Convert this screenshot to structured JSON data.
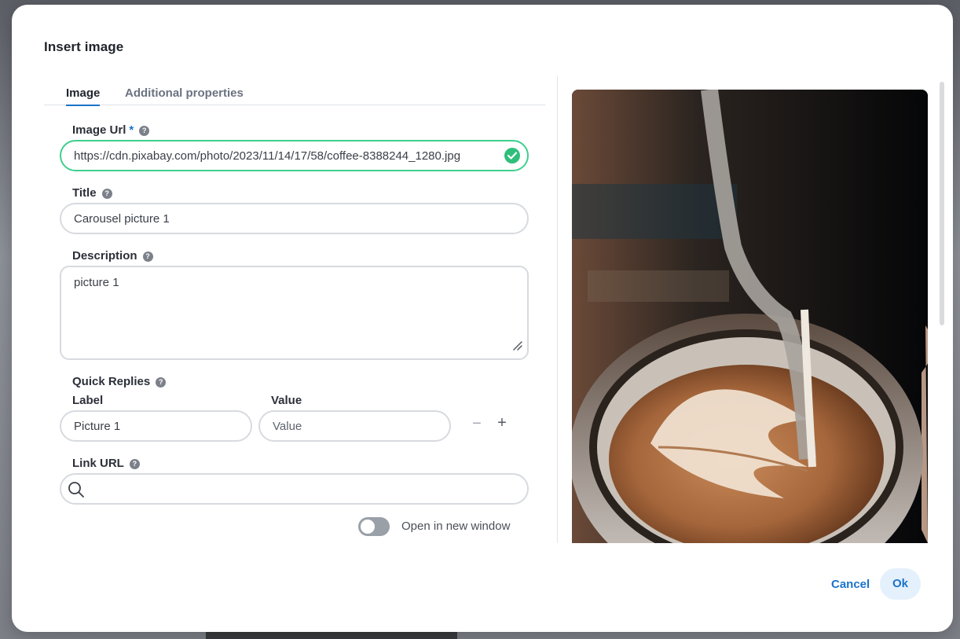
{
  "dialog": {
    "title": "Insert image"
  },
  "tabs": [
    {
      "label": "Image",
      "active": true
    },
    {
      "label": "Additional properties",
      "active": false
    }
  ],
  "form": {
    "image_url": {
      "label": "Image Url",
      "required_mark": "*",
      "value": "https://cdn.pixabay.com/photo/2023/11/14/17/58/coffee-8388244_1280.jpg",
      "status": "valid"
    },
    "title": {
      "label": "Title",
      "value": "Carousel picture 1"
    },
    "description": {
      "label": "Description",
      "value": "picture 1"
    },
    "quick_replies": {
      "label": "Quick Replies",
      "columns": {
        "label": "Label",
        "value": "Value"
      },
      "rows": [
        {
          "label": "Picture 1",
          "value_placeholder": "Value"
        }
      ],
      "remove_symbol": "−",
      "add_symbol": "+"
    },
    "link_url": {
      "label": "Link URL",
      "value": ""
    },
    "open_new_window": {
      "label": "Open in new window",
      "enabled": false
    }
  },
  "preview": {
    "subject": "latte art being poured into a ceramic coffee cup"
  },
  "footer": {
    "cancel_label": "Cancel",
    "ok_label": "Ok"
  },
  "colors": {
    "accent": "#1a73c9",
    "valid": "#3ecf8e",
    "ok_bg": "#e4f0fc",
    "toggle_off": "#9aa0a8"
  },
  "help_icon": "question-circle-icon"
}
